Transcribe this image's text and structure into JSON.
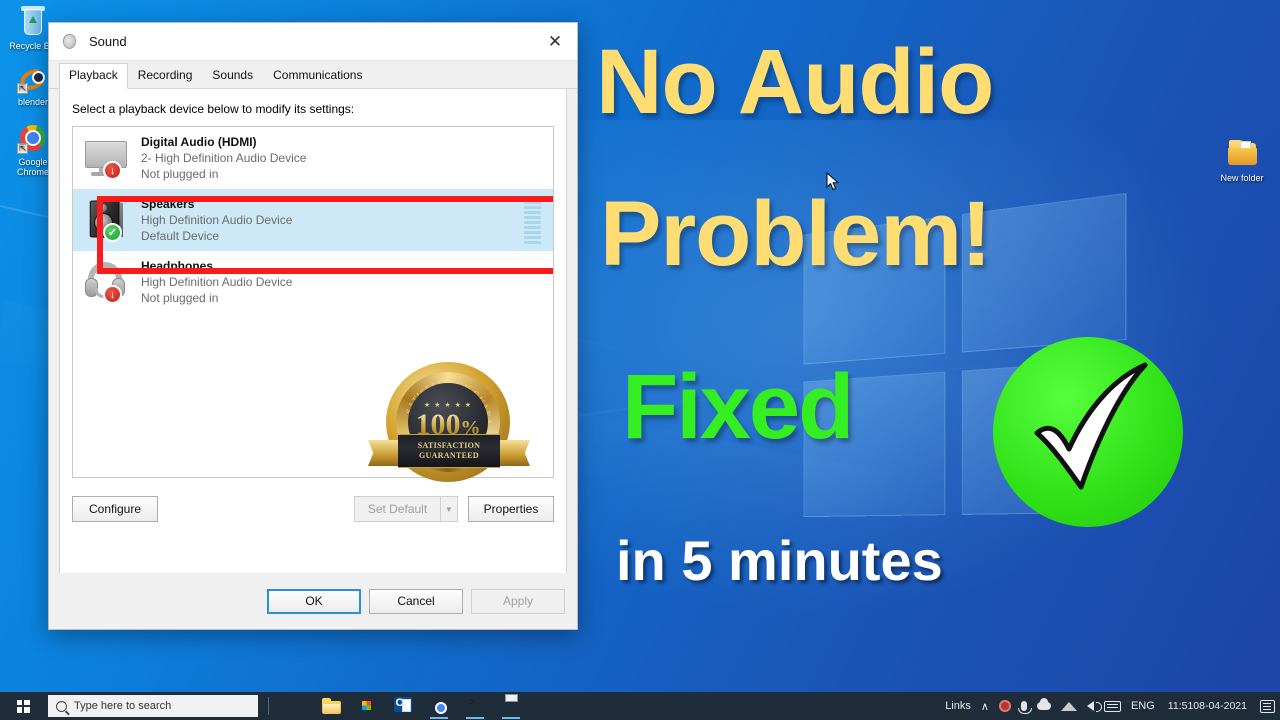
{
  "desktop": {
    "icons": [
      {
        "label": "Recycle Bin",
        "icon": "recycle-bin-icon"
      },
      {
        "label": "blender",
        "icon": "blender-icon"
      },
      {
        "label": "Google Chrome",
        "icon": "chrome-icon"
      },
      {
        "label": "New folder",
        "icon": "folder-icon"
      }
    ]
  },
  "dialog": {
    "title": "Sound",
    "title_icon": "speaker-icon",
    "close_label": "✕",
    "tabs": [
      {
        "label": "Playback",
        "active": true
      },
      {
        "label": "Recording",
        "active": false
      },
      {
        "label": "Sounds",
        "active": false
      },
      {
        "label": "Communications",
        "active": false
      }
    ],
    "hint": "Select a playback device below to modify its settings:",
    "devices": [
      {
        "name": "Digital Audio (HDMI)",
        "driver": "2- High Definition Audio Device",
        "state": "Not plugged in",
        "icon": "monitor-icon",
        "badge": "arrow-down-icon",
        "selected": false,
        "highlighted": false
      },
      {
        "name": "Speakers",
        "driver": "High Definition Audio Device",
        "state": "Default Device",
        "icon": "speaker-icon",
        "badge": "check-icon",
        "selected": true,
        "highlighted": true
      },
      {
        "name": "Headphones",
        "driver": "High Definition Audio Device",
        "state": "Not plugged in",
        "icon": "headphones-icon",
        "badge": "arrow-down-icon",
        "selected": false,
        "highlighted": false
      }
    ],
    "buttons": {
      "configure": "Configure",
      "set_default": "Set Default",
      "set_default_arrow": "▼",
      "properties": "Properties",
      "ok": "OK",
      "cancel": "Cancel",
      "apply": "Apply"
    }
  },
  "overlay": {
    "line1": "No Audio",
    "line2": "Problem!",
    "line3": "Fixed",
    "line4": "in 5 minutes",
    "colors": {
      "yellow": "#ffdd73",
      "green": "#35ee22",
      "white": "#ffffff",
      "red_box": "#fb1b1b",
      "check_circle": "#2fe016"
    },
    "badge": {
      "percent": "100",
      "percent_symbol": "%",
      "arc_text": "SATISFACTION GUARANTEED",
      "ribbon_line1": "SATISFACTION",
      "ribbon_line2": "GUARANTEED",
      "stars": "★ ★ ★ ★ ★"
    }
  },
  "taskbar": {
    "start_label": "Start",
    "search_placeholder": "Type here to search",
    "apps": [
      {
        "name": "microsoft-edge",
        "icon": "edge-icon",
        "running": false
      },
      {
        "name": "file-explorer",
        "icon": "file-explorer-icon",
        "running": false
      },
      {
        "name": "microsoft-store",
        "icon": "store-icon",
        "running": false
      },
      {
        "name": "outlook",
        "icon": "outlook-icon",
        "running": false
      },
      {
        "name": "google-chrome",
        "icon": "chrome-icon",
        "running": true
      },
      {
        "name": "terminal",
        "icon": "terminal-icon",
        "running": true
      },
      {
        "name": "printer-app",
        "icon": "printer-icon",
        "running": true
      }
    ],
    "tray": {
      "links_label": "Links",
      "chevron": "∧",
      "language": "ENG",
      "time": "11:51",
      "date": "08-04-2021",
      "items": [
        {
          "name": "record-icon"
        },
        {
          "name": "microphone-icon"
        },
        {
          "name": "onedrive-cloud-icon"
        },
        {
          "name": "network-wifi-icon"
        },
        {
          "name": "volume-icon"
        },
        {
          "name": "keyboard-icon"
        }
      ]
    }
  }
}
